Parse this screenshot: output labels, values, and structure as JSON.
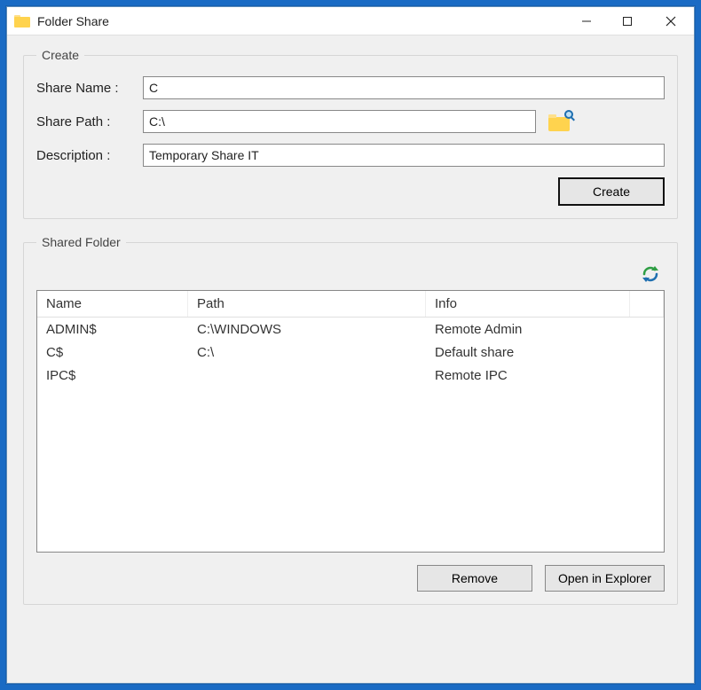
{
  "window": {
    "title": "Folder Share"
  },
  "create_group": {
    "legend": "Create",
    "labels": {
      "share_name": "Share Name :",
      "share_path": "Share Path :",
      "description": "Description :"
    },
    "values": {
      "share_name": "C",
      "share_path": "C:\\",
      "description": "Temporary Share IT"
    },
    "create_button": "Create"
  },
  "shared_group": {
    "legend": "Shared Folder",
    "columns": {
      "name": "Name",
      "path": "Path",
      "info": "Info"
    },
    "rows": [
      {
        "name": "ADMIN$",
        "path": "C:\\WINDOWS",
        "info": "Remote Admin"
      },
      {
        "name": "C$",
        "path": "C:\\",
        "info": "Default share"
      },
      {
        "name": "IPC$",
        "path": "",
        "info": "Remote IPC"
      }
    ],
    "buttons": {
      "remove": "Remove",
      "open": "Open in Explorer"
    }
  }
}
